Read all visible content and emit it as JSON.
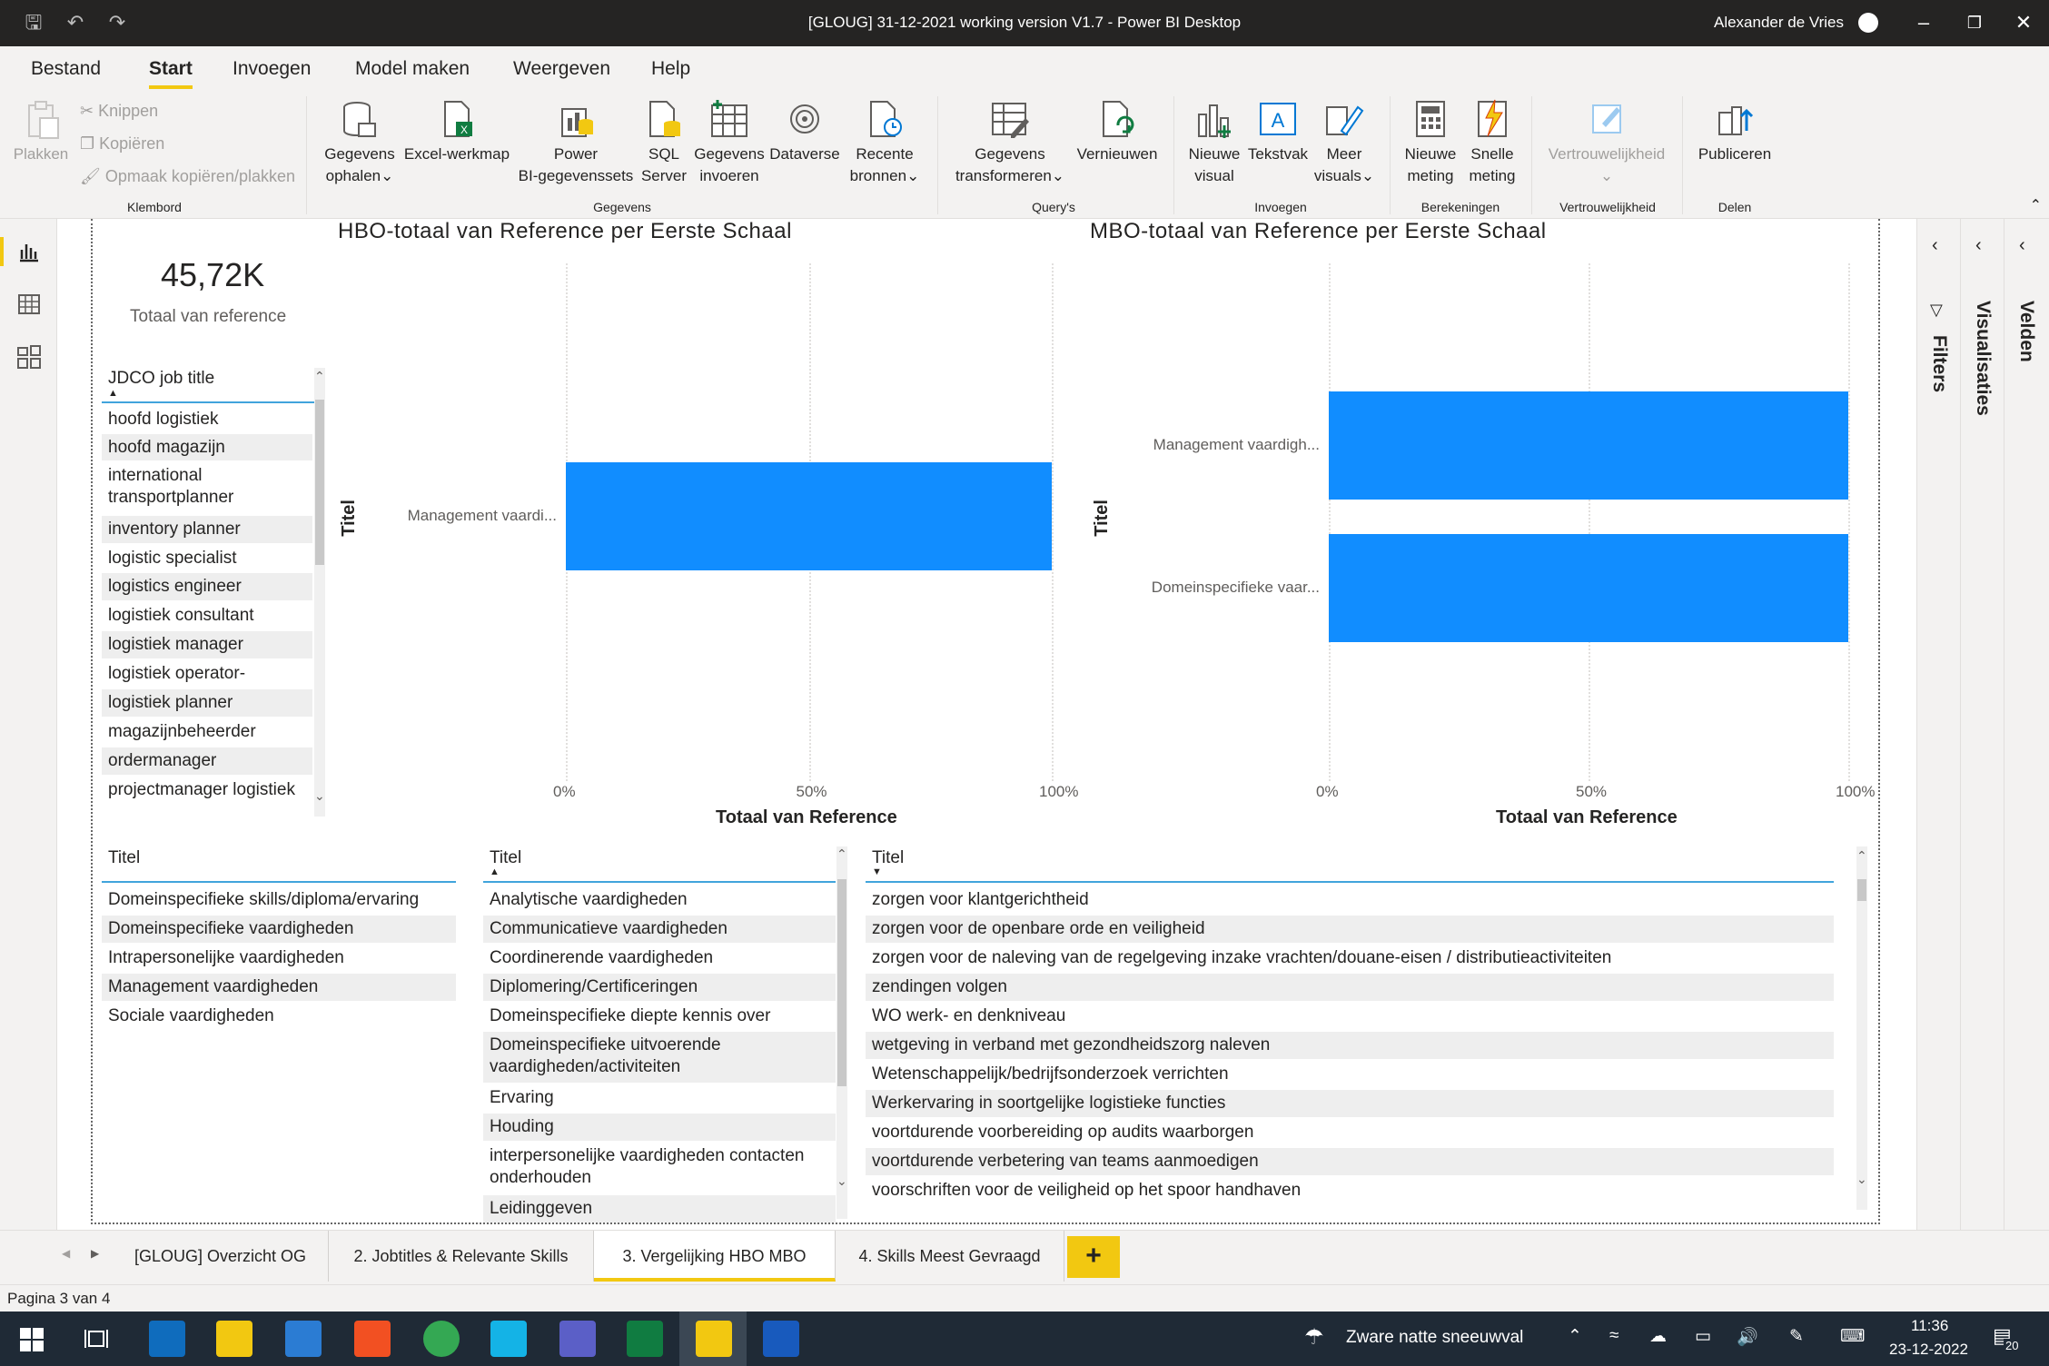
{
  "window": {
    "title": "[GLOUG] 31-12-2021 working version V1.7 - Power BI Desktop",
    "user": "Alexander de Vries"
  },
  "menu": [
    "Bestand",
    "Start",
    "Invoegen",
    "Model maken",
    "Weergeven",
    "Help"
  ],
  "ribbon": {
    "plakken": "Plakken",
    "knippen": "Knippen",
    "kopieren": "Kopiëren",
    "opmaak": "Opmaak kopiëren/plakken",
    "klembord": "Klembord",
    "gegevens_ophalen": [
      "Gegevens",
      "ophalen"
    ],
    "excel": "Excel-werkmap",
    "power_bi": [
      "Power",
      "BI-gegevenssets"
    ],
    "sql": [
      "SQL",
      "Server"
    ],
    "gegevens_invoeren": [
      "Gegevens",
      "invoeren"
    ],
    "dataverse": "Dataverse",
    "recente": [
      "Recente",
      "bronnen"
    ],
    "gegevens_grp": "Gegevens",
    "transformeren": [
      "Gegevens",
      "transformeren"
    ],
    "vernieuwen": "Vernieuwen",
    "querys": "Query's",
    "nieuwe_visual": [
      "Nieuwe",
      "visual"
    ],
    "tekstvak": "Tekstvak",
    "meer_visuals": [
      "Meer",
      "visuals"
    ],
    "invoegen_grp": "Invoegen",
    "nieuwe_meting": [
      "Nieuwe",
      "meting"
    ],
    "snelle_meting": [
      "Snelle",
      "meting"
    ],
    "berekeningen": "Berekeningen",
    "vertrouwelijkheid": "Vertrouwelijkheid",
    "vertr_grp": "Vertrouwelijkheid",
    "publiceren": "Publiceren",
    "delen": "Delen"
  },
  "panes": {
    "filters": "Filters",
    "visualisaties": "Visualisaties",
    "velden": "Velden"
  },
  "kpi": {
    "value": "45,72K",
    "label": "Totaal van reference"
  },
  "job_slicer": {
    "header": "JDCO job title",
    "items": [
      "hoofd logistiek",
      "hoofd magazijn",
      "international transportplanner",
      "inventory planner",
      "logistic specialist",
      "logistics engineer",
      "logistiek consultant",
      "logistiek manager",
      "logistiek operator-",
      "logistiek planner",
      "magazijnbeheerder",
      "ordermanager",
      "projectmanager logistiek"
    ]
  },
  "titel1": {
    "header": "Titel",
    "items": [
      "Domeinspecifieke skills/diploma/ervaring",
      "Domeinspecifieke vaardigheden",
      "Intrapersonelijke vaardigheden",
      "Management vaardigheden",
      "Sociale vaardigheden"
    ]
  },
  "titel2": {
    "header": "Titel",
    "items": [
      "Analytische vaardigheden",
      "Communicatieve vaardigheden",
      "Coordinerende vaardigheden",
      "Diplomering/Certificeringen",
      "Domeinspecifieke diepte kennis over",
      "Domeinspecifieke uitvoerende vaardigheden/activiteiten",
      "Ervaring",
      "Houding",
      "interpersonelijke vaardigheden contacten onderhouden",
      "Leidinggeven"
    ]
  },
  "titel3": {
    "header": "Titel",
    "items": [
      "zorgen voor klantgerichtheid",
      "zorgen voor de openbare orde en veiligheid",
      "zorgen voor de naleving van de regelgeving inzake vrachten/douane-eisen / distributieactiviteiten",
      "zendingen volgen",
      "WO werk- en denkniveau",
      "wetgeving in verband met gezondheidszorg naleven",
      "Wetenschappelijk/bedrijfsonderzoek verrichten",
      "Werkervaring in soortgelijke logistieke functies",
      "voortdurende voorbereiding op audits waarborgen",
      "voortdurende verbetering van teams aanmoedigen",
      "voorschriften voor de veiligheid op het spoor handhaven"
    ]
  },
  "chart_data": [
    {
      "type": "bar",
      "orientation": "horizontal",
      "title": "HBO-totaal van Reference per Eerste Schaal",
      "ylabel": "Titel",
      "xlabel": "Totaal van Reference",
      "categories": [
        "Management vaardi..."
      ],
      "values": [
        100
      ],
      "xlim": [
        0,
        100
      ],
      "xticks": [
        "0%",
        "50%",
        "100%"
      ],
      "color": "#118dff"
    },
    {
      "type": "bar",
      "orientation": "horizontal",
      "title": "MBO-totaal van Reference per Eerste Schaal",
      "ylabel": "Titel",
      "xlabel": "Totaal van Reference",
      "categories": [
        "Management vaardigh...",
        "Domeinspecifieke vaar..."
      ],
      "values": [
        100,
        100
      ],
      "xlim": [
        0,
        100
      ],
      "xticks": [
        "0%",
        "50%",
        "100%"
      ],
      "color": "#118dff"
    }
  ],
  "tabs": [
    "[GLOUG] Overzicht OG",
    "2. Jobtitles & Relevante Skills",
    "3. Vergelijking HBO MBO",
    "4. Skills Meest Gevraagd"
  ],
  "status": "Pagina 3 van 4",
  "taskbar": {
    "weather": "Zware natte sneeuwval",
    "time": "11:36",
    "date": "23-12-2022",
    "notif": "20"
  }
}
